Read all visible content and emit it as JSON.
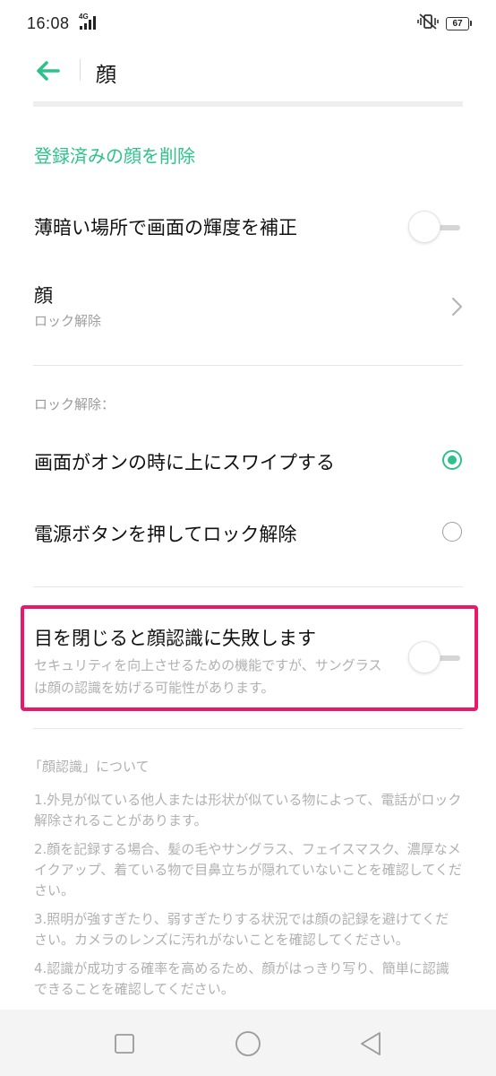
{
  "status_bar": {
    "time": "16:08",
    "network": "4G",
    "battery": "67",
    "icons": [
      "signal-icon",
      "vibrate-icon",
      "battery-icon"
    ]
  },
  "header": {
    "title": "顔",
    "back_icon": "arrow-left-icon"
  },
  "settings": {
    "delete_face_label": "登録済みの顔を削除",
    "brightness": {
      "label": "薄暗い場所で画面の輝度を補正",
      "enabled": false
    },
    "face_item": {
      "label": "顔",
      "sub": "ロック解除"
    },
    "unlock_section": {
      "label": "ロック解除：",
      "options": [
        {
          "label": "画面がオンの時に上にスワイプする",
          "selected": true
        },
        {
          "label": "電源ボタンを押してロック解除",
          "selected": false
        }
      ]
    },
    "eyes_closed": {
      "label": "目を閉じると顔認識に失敗します",
      "desc": "セキュリティを向上させるための機能ですが、サングラスは顔の認識を妨げる可能性があります。",
      "enabled": false
    }
  },
  "about": {
    "title": "「顔認識」について",
    "items": [
      "1.外見が似ている他人または形状が似ている物によって、電話がロック解除されることがあります。",
      "2.顔を記録する場合、髪の毛やサングラス、フェイスマスク、濃厚なメイクアップ、着ている物で目鼻立ちが隠れていないことを確認してください。",
      "3.照明が強すぎたり、弱すぎたりする状況では顔の記録を避けてください。カメラのレンズに汚れがないことを確認してください。",
      "4.認識が成功する確率を高めるため、顔がはっきり写り、簡単に認識できることを確認してください。"
    ]
  },
  "colors": {
    "accent": "#2ec28a",
    "highlight": "#e8196b",
    "secondary_text": "#9e9e9e"
  },
  "nav_bar": {
    "icons": [
      "square-recents-icon",
      "circle-home-icon",
      "triangle-back-icon"
    ]
  }
}
